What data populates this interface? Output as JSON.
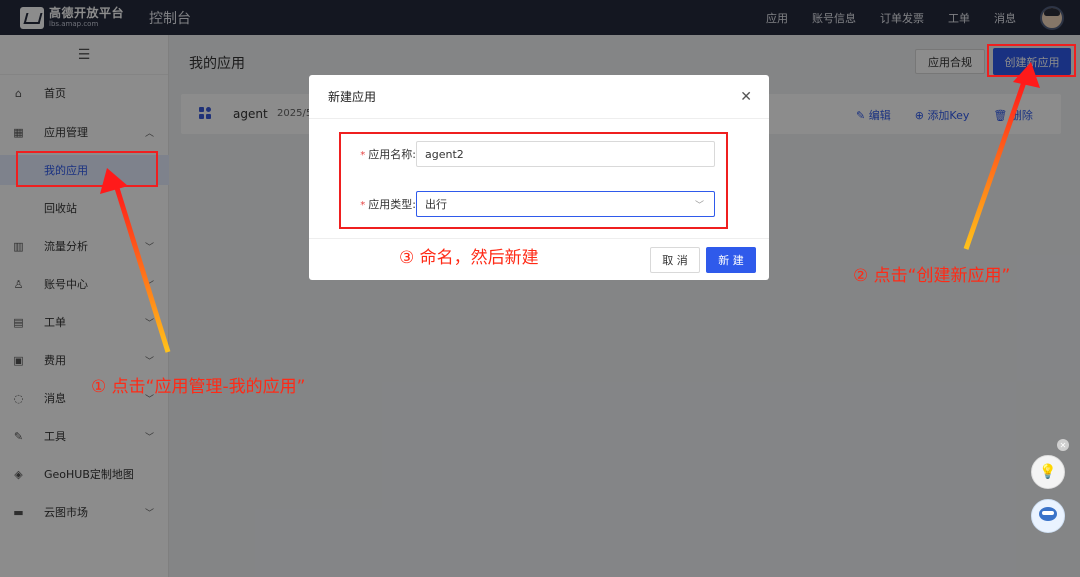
{
  "topbar": {
    "logo_text": "高德开放平台",
    "logo_subtext": "lbs.amap.com",
    "console_title": "控制台",
    "nav": [
      "应用",
      "账号信息",
      "订单发票",
      "工单",
      "消息"
    ]
  },
  "sidebar": {
    "items": [
      {
        "icon": "home-icon",
        "label": "首页"
      },
      {
        "icon": "grid-icon",
        "label": "应用管理",
        "expanded": true
      },
      {
        "label": "我的应用",
        "active": true
      },
      {
        "label": "回收站"
      },
      {
        "icon": "chart-icon",
        "label": "流量分析"
      },
      {
        "icon": "user-icon",
        "label": "账号中心"
      },
      {
        "icon": "ticket-icon",
        "label": "工单"
      },
      {
        "icon": "billing-icon",
        "label": "费用"
      },
      {
        "icon": "message-icon",
        "label": "消息"
      },
      {
        "icon": "tool-icon",
        "label": "工具"
      },
      {
        "icon": "layers-icon",
        "label": "GeoHUB定制地图"
      },
      {
        "icon": "store-icon",
        "label": "云图市场"
      }
    ]
  },
  "main": {
    "title": "我的应用",
    "compliance_button": "应用合规",
    "create_button": "创建新应用",
    "app": {
      "name": "agent",
      "date": "2025/5",
      "actions": [
        "编辑",
        "添加Key",
        "删除"
      ]
    }
  },
  "modal": {
    "title": "新建应用",
    "name_label": "应用名称:",
    "name_value": "agent2",
    "type_label": "应用类型:",
    "type_value": "出行",
    "cancel_button": "取 消",
    "create_button": "新 建"
  },
  "annotations": {
    "step1": "① 点击“应用管理-我的应用”",
    "step2": "② 点击“创建新应用”",
    "step3": "③ 命名，然后新建"
  },
  "colors": {
    "accent": "#2f5aeb",
    "highlight": "#ef1f1f",
    "topbar": "#252a3d"
  }
}
